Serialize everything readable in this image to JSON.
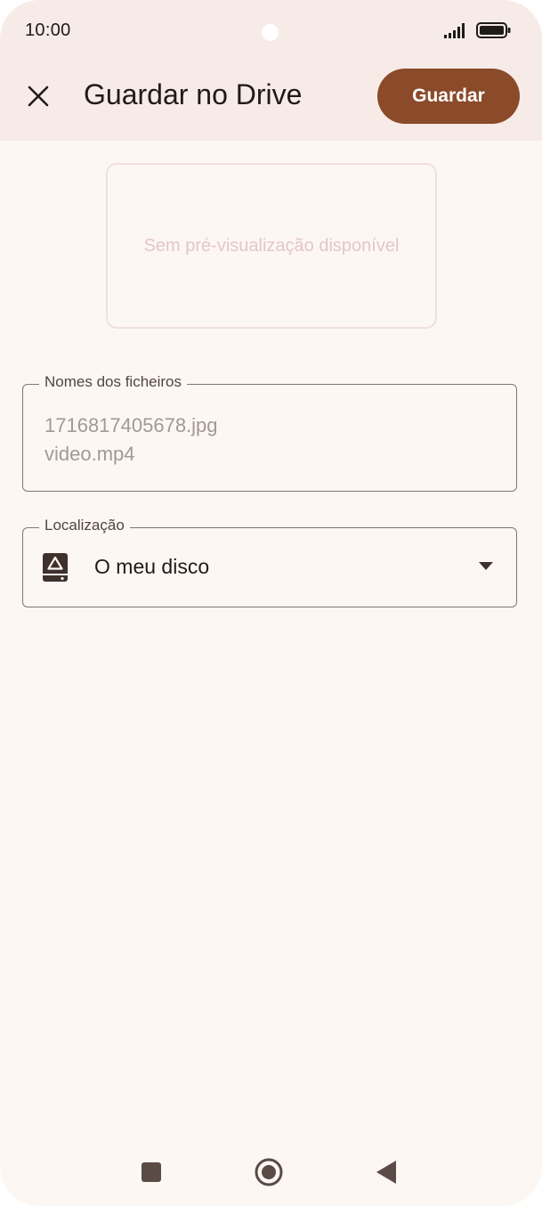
{
  "status_bar": {
    "time": "10:00",
    "icons": [
      "signal-icon",
      "battery-icon"
    ]
  },
  "app_bar": {
    "close_icon": "close-icon",
    "title": "Guardar no Drive",
    "save_label": "Guardar"
  },
  "preview": {
    "text": "Sem pré-visualização disponível"
  },
  "file_names": {
    "label": "Nomes dos ficheiros",
    "files": [
      "1716817405678.jpg",
      "video.mp4"
    ]
  },
  "location": {
    "label": "Localização",
    "icon": "drive-icon",
    "value": "O meu disco",
    "dropdown_icon": "dropdown-arrow-icon"
  },
  "nav_bar": {
    "icons": [
      "recent-apps-icon",
      "home-icon",
      "back-icon"
    ]
  },
  "colors": {
    "accent": "#8b4a2a",
    "background": "#fdf7f3",
    "app_bar_background": "#f6ebe6"
  }
}
